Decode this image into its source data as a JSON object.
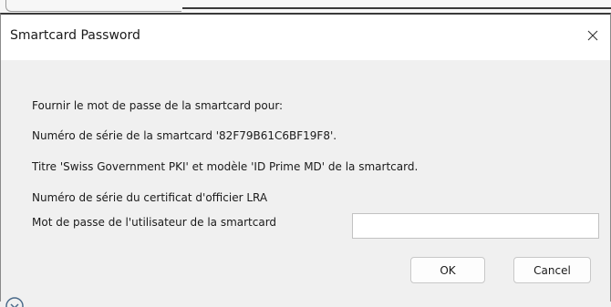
{
  "dialog": {
    "title": "Smartcard Password",
    "close_icon": "close-icon",
    "lines": [
      "Fournir le mot de passe de la smartcard pour:",
      "Numéro de série de la smartcard '82F79B61C6BF19F8'.",
      "Titre 'Swiss Government PKI' et modèle 'ID Prime MD' de la smartcard.",
      "Numéro de série du certificat d'officier LRA"
    ],
    "password_label": "Mot de passe de l'utilisateur de la smartcard",
    "password_value": "",
    "ok_label": "OK",
    "cancel_label": "Cancel"
  },
  "colors": {
    "dialog_background": "#f0f0f0",
    "titlebar_background": "#ffffff",
    "input_background": "#ffffff"
  }
}
